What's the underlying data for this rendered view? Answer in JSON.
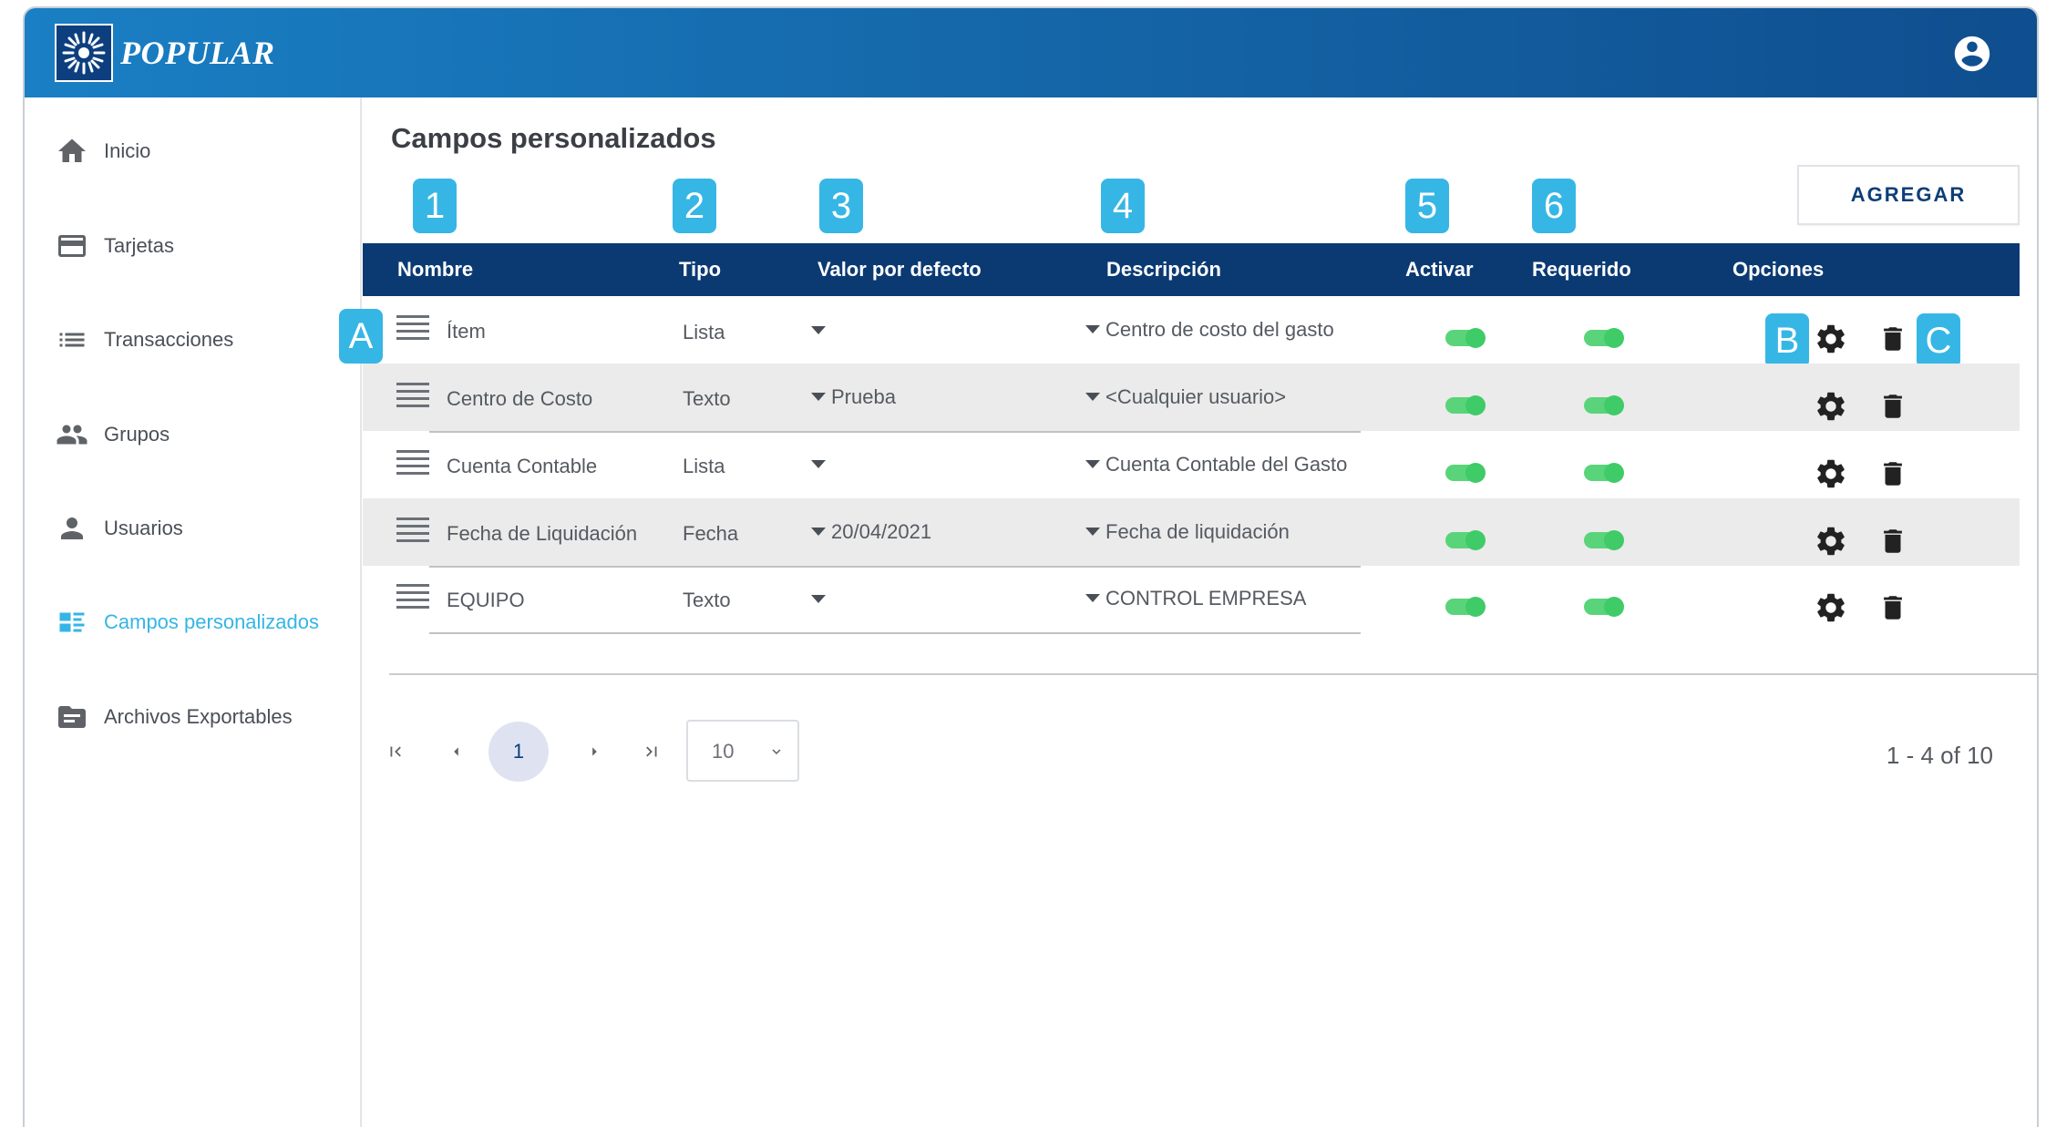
{
  "header": {
    "brand": "POPULAR"
  },
  "sidebar": {
    "items": [
      {
        "label": "Inicio"
      },
      {
        "label": "Tarjetas"
      },
      {
        "label": "Transacciones"
      },
      {
        "label": "Grupos"
      },
      {
        "label": "Usuarios"
      },
      {
        "label": "Campos personalizados",
        "active": true
      },
      {
        "label": "Archivos Exportables"
      }
    ]
  },
  "main": {
    "title": "Campos personalizados",
    "add_button": "AGREGAR",
    "columns": [
      "Nombre",
      "Tipo",
      "Valor por defecto",
      "Descripción",
      "Activar",
      "Requerido",
      "Opciones"
    ],
    "callouts": [
      "1",
      "2",
      "3",
      "4",
      "5",
      "6",
      "A",
      "B",
      "C"
    ],
    "rows": [
      {
        "nombre": "Ítem",
        "tipo": "Lista",
        "valor": "",
        "descripcion": "Centro de costo del gasto",
        "activar": true,
        "requerido": true
      },
      {
        "nombre": "Centro de Costo",
        "tipo": "Texto",
        "valor": "Prueba",
        "descripcion": "<Cualquier usuario>",
        "activar": true,
        "requerido": true
      },
      {
        "nombre": "Cuenta Contable",
        "tipo": "Lista",
        "valor": "",
        "descripcion": "Cuenta Contable del Gasto",
        "activar": true,
        "requerido": true
      },
      {
        "nombre": "Fecha de Liquidación",
        "tipo": "Fecha",
        "valor": "20/04/2021",
        "descripcion": "Fecha de liquidación",
        "activar": true,
        "requerido": true
      },
      {
        "nombre": "EQUIPO",
        "tipo": "Texto",
        "valor": "",
        "descripcion": "CONTROL EMPRESA",
        "activar": true,
        "requerido": true
      }
    ]
  },
  "pagination": {
    "current_page": "1",
    "page_size": "10",
    "range": "1 - 4 of 10"
  },
  "colors": {
    "header_start": "#1a7fc4",
    "header_end": "#0f4e8f",
    "table_header": "#0b3a73",
    "accent": "#36b6e5",
    "toggle_on": "#3fcb67"
  }
}
